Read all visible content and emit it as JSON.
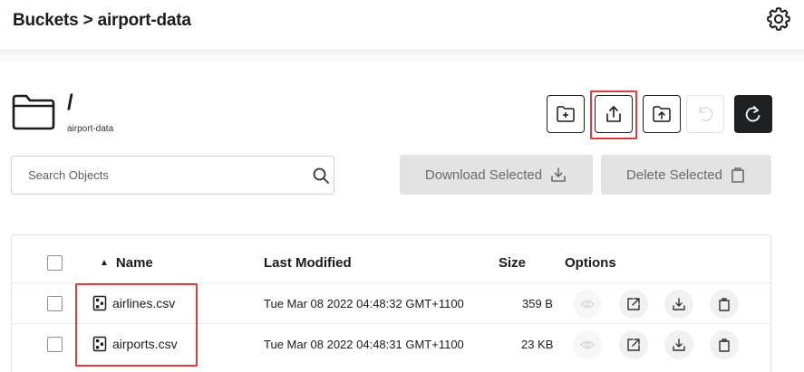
{
  "header": {
    "breadcrumb": "Buckets > airport-data",
    "settings_icon": "gear-icon"
  },
  "location": {
    "path": "/",
    "bucket": "airport-data",
    "folder_icon": "folder-icon"
  },
  "toolbar": {
    "buttons": [
      {
        "icon": "new-folder-icon",
        "state": "enabled"
      },
      {
        "icon": "upload-file-icon",
        "state": "highlighted"
      },
      {
        "icon": "upload-folder-icon",
        "state": "enabled"
      },
      {
        "icon": "rewind-icon",
        "state": "disabled"
      },
      {
        "icon": "refresh-icon",
        "state": "primary"
      }
    ]
  },
  "search": {
    "placeholder": "Search Objects",
    "value": ""
  },
  "actions": {
    "download_label": "Download Selected",
    "delete_label": "Delete Selected"
  },
  "table": {
    "columns": {
      "name": "Name",
      "last_modified": "Last Modified",
      "size": "Size",
      "options": "Options"
    },
    "sort_indicator": "▲",
    "rows": [
      {
        "name": "airlines.csv",
        "last_modified": "Tue Mar 08 2022 04:48:32 GMT+1100",
        "size": "359 B"
      },
      {
        "name": "airports.csv",
        "last_modified": "Tue Mar 08 2022 04:48:31 GMT+1100",
        "size": "23 KB"
      }
    ]
  },
  "colors": {
    "highlight": "#e23b3b",
    "primary_button": "#1e2024",
    "disabled_button": "#e3e3e3"
  }
}
